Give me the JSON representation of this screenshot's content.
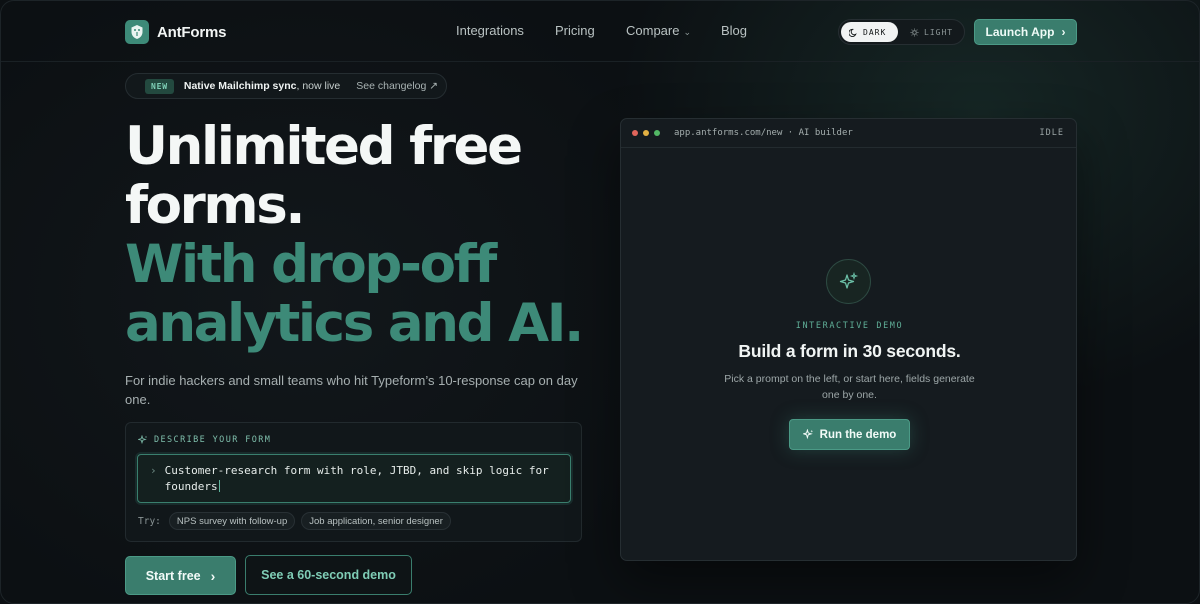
{
  "header": {
    "brand": "AntForms",
    "nav": [
      {
        "label": "Integrations"
      },
      {
        "label": "Pricing"
      },
      {
        "label": "Compare"
      },
      {
        "label": "Blog"
      }
    ],
    "theme": {
      "dark_label": "DARK",
      "light_label": "LIGHT",
      "selected": "dark"
    },
    "launch_label": "Launch App"
  },
  "announcement": {
    "badge": "NEW",
    "bold_text": "Native Mailchimp sync",
    "text": ", now live",
    "link_label": "See changelog ↗"
  },
  "hero": {
    "title_line1": "Unlimited free",
    "title_line2": "forms.",
    "title_line3": "With drop-off",
    "title_line4": "analytics and AI.",
    "subtitle": "For indie hackers and small teams who hit Typeform’s 10-response cap on day one."
  },
  "describe": {
    "label": "DESCRIBE YOUR FORM",
    "prompt_value": "Customer-research form with role, JTBD, and skip logic for founders",
    "try_label": "Try:",
    "suggestions": [
      "NPS survey with follow-up",
      "Job application, senior designer"
    ]
  },
  "cta": {
    "primary_label": "Start free",
    "secondary_label": "See a 60-second demo"
  },
  "demo": {
    "url": "app.antforms.com/new · AI builder",
    "status": "IDLE",
    "eyebrow": "INTERACTIVE DEMO",
    "title": "Build a form in 30 seconds.",
    "description": "Pick a prompt on the left, or start here, fields generate one by one.",
    "run_label": "Run the demo"
  },
  "colors": {
    "accent": "#3d8a78",
    "background": "#0c1013"
  }
}
